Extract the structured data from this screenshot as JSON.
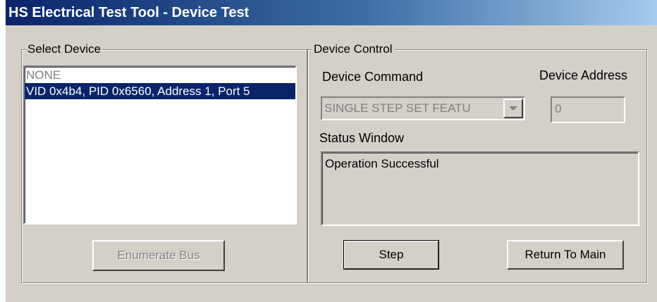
{
  "window": {
    "title": "HS Electrical Test Tool - Device Test"
  },
  "select_device": {
    "group_label": "Select Device",
    "items": [
      {
        "label": "NONE",
        "selected": false
      },
      {
        "label": "VID 0x4b4, PID 0x6560, Address 1, Port 5",
        "selected": true
      }
    ],
    "enumerate_label": "Enumerate Bus"
  },
  "device_control": {
    "group_label": "Device Control",
    "command_label": "Device Command",
    "command_value": "SINGLE STEP SET FEATU",
    "address_label": "Device Address",
    "address_value": "0",
    "status_label": "Status Window",
    "status_text": "Operation Successful",
    "step_label": "Step",
    "return_label": "Return To Main"
  },
  "colors": {
    "face": "#d4d0c8",
    "selection": "#0a246a",
    "title_start": "#0a246a",
    "title_end": "#a6caf0"
  }
}
